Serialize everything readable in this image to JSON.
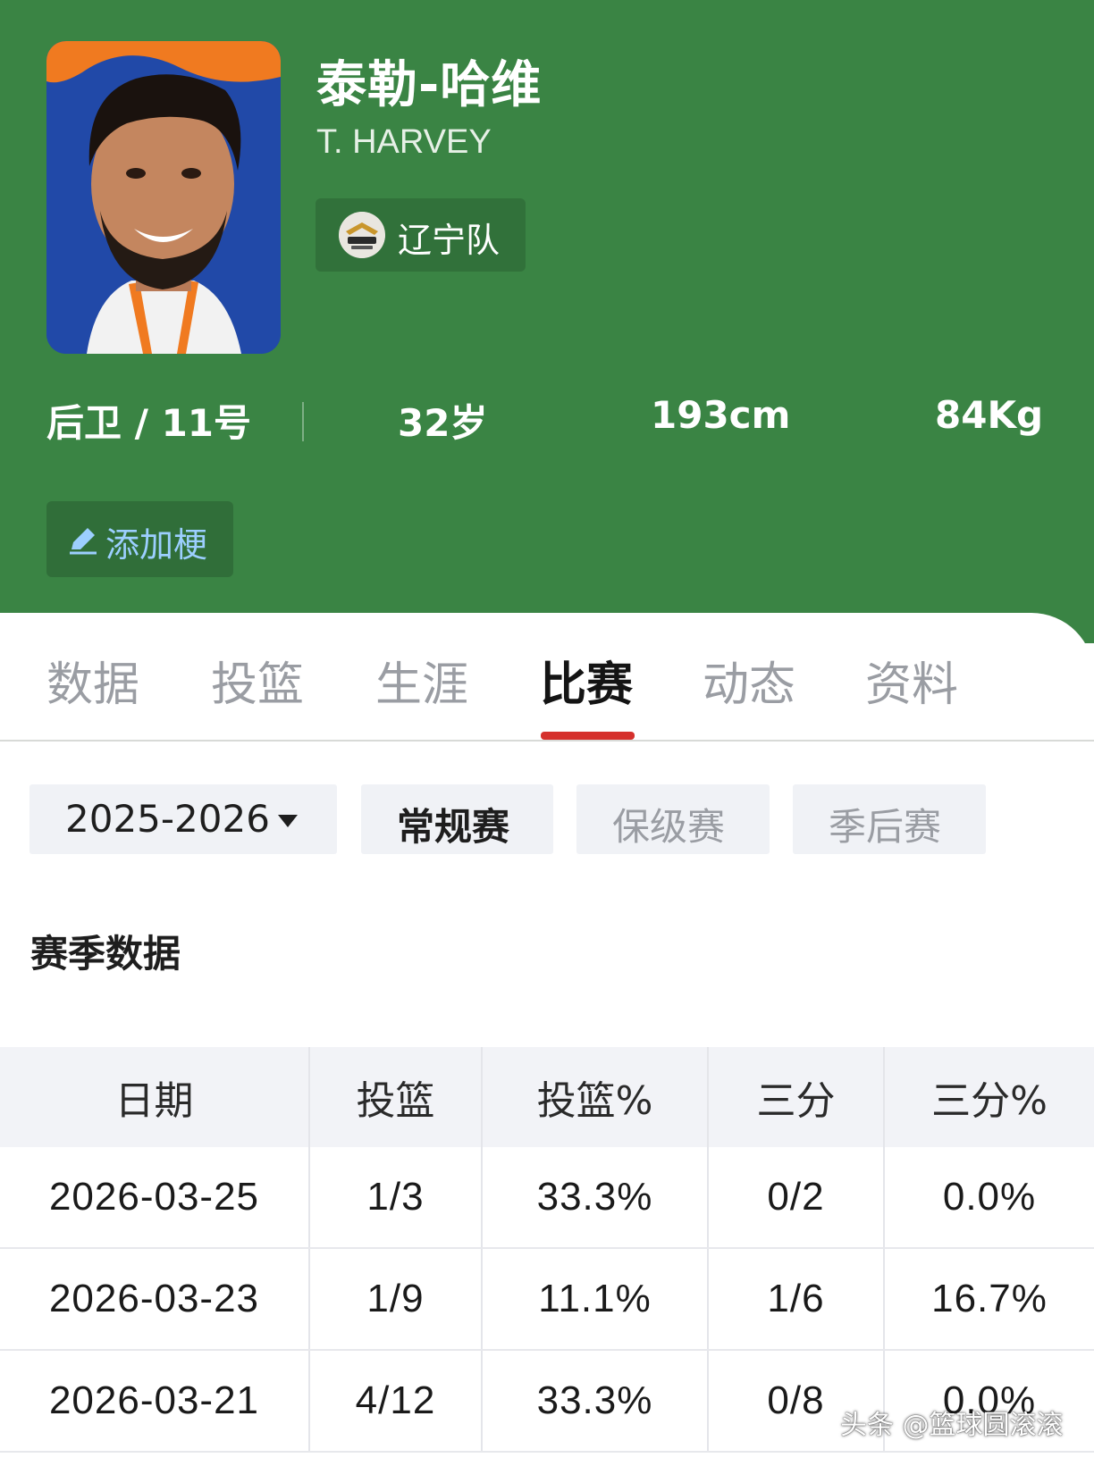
{
  "player": {
    "name_cn": "泰勒-哈维",
    "name_en": "T. HARVEY",
    "team": "辽宁队",
    "position_number": "后卫 / 11号",
    "age": "32岁",
    "height": "193cm",
    "weight": "84Kg",
    "add_tag_label": "添加梗"
  },
  "colors": {
    "header_bg": "#3a8444",
    "active_tab_indicator": "#d5302c",
    "add_tag_text": "#9ccfff"
  },
  "tabs": [
    {
      "label": "数据",
      "active": false
    },
    {
      "label": "投篮",
      "active": false
    },
    {
      "label": "生涯",
      "active": false
    },
    {
      "label": "比赛",
      "active": true
    },
    {
      "label": "动态",
      "active": false
    },
    {
      "label": "资料",
      "active": false
    }
  ],
  "filters": {
    "season": "2025-2026",
    "types": [
      {
        "label": "常规赛",
        "selected": true
      },
      {
        "label": "保级赛",
        "selected": false
      },
      {
        "label": "季后赛",
        "selected": false
      }
    ]
  },
  "section_title": "赛季数据",
  "table": {
    "headers": [
      "日期",
      "投篮",
      "投篮%",
      "三分",
      "三分%"
    ],
    "rows": [
      [
        "2026-03-25",
        "1/3",
        "33.3%",
        "0/2",
        "0.0%"
      ],
      [
        "2026-03-23",
        "1/9",
        "11.1%",
        "1/6",
        "16.7%"
      ],
      [
        "2026-03-21",
        "4/12",
        "33.3%",
        "0/8",
        "0.0%"
      ]
    ]
  },
  "watermark": "头条 @篮球圆滚滚"
}
